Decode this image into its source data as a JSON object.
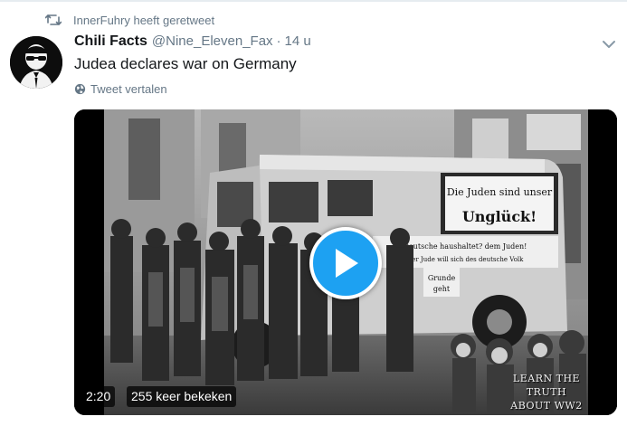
{
  "retweet": {
    "icon": "retweet-icon",
    "text": "InnerFuhry heeft geretweet"
  },
  "author": {
    "display_name": "Chili Facts",
    "handle": "@Nine_Eleven_Fax",
    "separator": "·",
    "time": "14 u",
    "avatar_icon": "masked-face-avatar"
  },
  "tweet": {
    "text": "Judea declares war on Germany",
    "translate_label": "Tweet vertalen",
    "translate_icon": "globe-icon",
    "menu_icon": "chevron-down-icon"
  },
  "video": {
    "duration": "2:20",
    "views": "255 keer bekeken",
    "watermark_line1": "LEARN THE TRUTH",
    "watermark_line2": "ABOUT WW2",
    "play_icon": "play-icon",
    "truck_sign_line1": "Die Juden sind unser",
    "truck_sign_line2": "Unglück!",
    "truck_banner_line1": "Deutsche haushaltet? dem Juden!",
    "truck_banner_line2": "Der Jude will sich des deutsche Volk",
    "truck_side_line1": "Grunde",
    "truck_side_line2": "geht"
  },
  "colors": {
    "accent": "#1da1f2",
    "text_primary": "#14171a",
    "text_secondary": "#657786"
  }
}
